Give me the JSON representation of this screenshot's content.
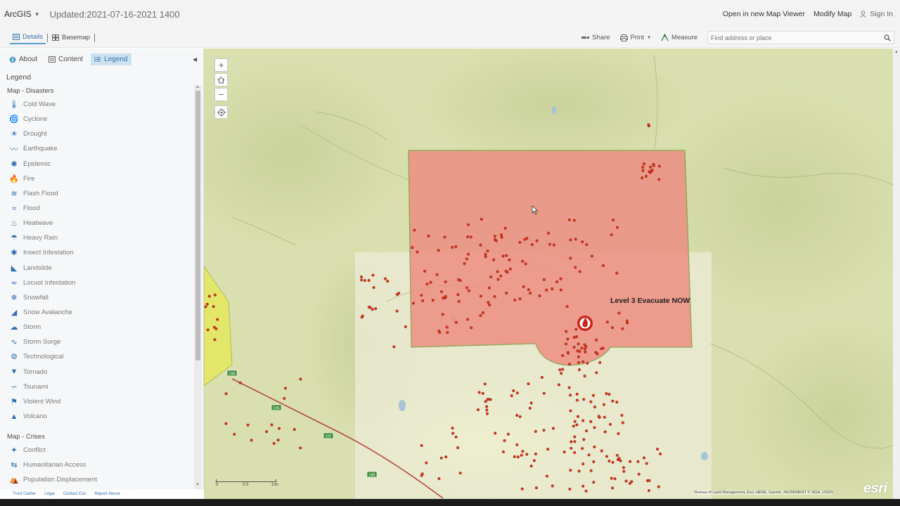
{
  "header": {
    "app_name": "ArcGIS",
    "title": "Updated:2021-07-16-2021 1400",
    "links": [
      "Open in new Map Viewer",
      "Modify Map"
    ],
    "sign_in": "Sign In"
  },
  "toolbar": {
    "tabs": [
      "Details",
      "Basemap"
    ],
    "share": "Share",
    "print": "Print",
    "measure": "Measure",
    "search_placeholder": "Find address or place"
  },
  "panel": {
    "tabs": [
      "About",
      "Content",
      "Legend"
    ],
    "legend_heading": "Legend",
    "group_disasters": "Map - Disasters",
    "disasters": [
      {
        "label": "Cold Wave",
        "icon": "cold-wave-icon"
      },
      {
        "label": "Cyclone",
        "icon": "cyclone-icon"
      },
      {
        "label": "Drought",
        "icon": "drought-icon"
      },
      {
        "label": "Earthquake",
        "icon": "earthquake-icon"
      },
      {
        "label": "Epidemic",
        "icon": "epidemic-icon"
      },
      {
        "label": "Fire",
        "icon": "fire-icon"
      },
      {
        "label": "Flash Flood",
        "icon": "flash-flood-icon"
      },
      {
        "label": "Flood",
        "icon": "flood-icon"
      },
      {
        "label": "Heatwave",
        "icon": "heatwave-icon"
      },
      {
        "label": "Heavy Rain",
        "icon": "heavy-rain-icon"
      },
      {
        "label": "Insect Infestation",
        "icon": "insect-infestation-icon"
      },
      {
        "label": "Landslide",
        "icon": "landslide-icon"
      },
      {
        "label": "Locust Infestation",
        "icon": "locust-infestation-icon"
      },
      {
        "label": "Snowfall",
        "icon": "snowfall-icon"
      },
      {
        "label": "Snow Avalanche",
        "icon": "snow-avalanche-icon"
      },
      {
        "label": "Storm",
        "icon": "storm-icon"
      },
      {
        "label": "Storm Surge",
        "icon": "storm-surge-icon"
      },
      {
        "label": "Technological",
        "icon": "technological-icon"
      },
      {
        "label": "Tornado",
        "icon": "tornado-icon"
      },
      {
        "label": "Tsunami",
        "icon": "tsunami-icon"
      },
      {
        "label": "Violent Wind",
        "icon": "violent-wind-icon"
      },
      {
        "label": "Volcano",
        "icon": "volcano-icon"
      }
    ],
    "group_crises": "Map - Crises",
    "crises": [
      {
        "label": "Conflict",
        "icon": "conflict-icon"
      },
      {
        "label": "Humanitarian Access",
        "icon": "humanitarian-access-icon"
      },
      {
        "label": "Population Displacement",
        "icon": "population-displacement-icon"
      }
    ],
    "footer": [
      "Trust Center",
      "Legal",
      "Contact Esri",
      "Report Abuse"
    ]
  },
  "map": {
    "evacuation_label": "Level 3 Evacuate NOW",
    "scale_labels": [
      "0",
      "0.5",
      "1mi"
    ],
    "attribution": "Bureau of Land Management, Esri, HERE, Garmin, INCREMENT P, NGA, USGS",
    "logo": "esri",
    "route_shields": [
      "195",
      "195",
      "107",
      "195"
    ],
    "colors": {
      "terrain": "#d9dfae",
      "evac_zone": "#ee8b80",
      "adjacent_zone": "#e5ea5a",
      "points": "#d9381e",
      "accent": "#55a0cf"
    }
  }
}
